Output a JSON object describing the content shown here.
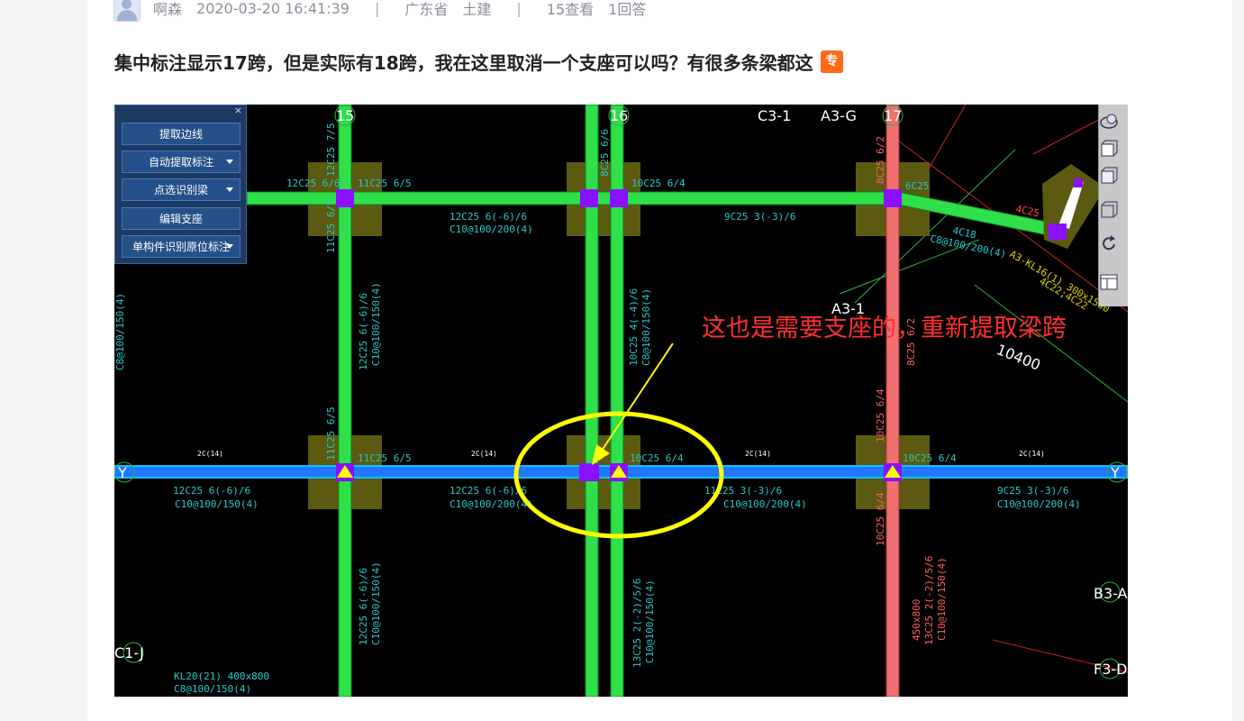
{
  "meta": {
    "author": "啊森",
    "datetime": "2020-03-20 16:41:39",
    "region": "广东省",
    "category": "土建",
    "views": "15查看",
    "answers": "1回答"
  },
  "question": {
    "title": "集中标注显示17跨，但是实际有18跨，我在这里取消一个支座可以吗？有很多条梁都这",
    "badge": "专"
  },
  "toolbar": {
    "close": "×",
    "buttons": [
      "提取边线",
      "自动提取标注",
      "点选识别梁",
      "编辑支座",
      "单构件识别原位标注"
    ]
  },
  "cad": {
    "axis_labels": [
      "15",
      "16",
      "17",
      "C3-1",
      "A3-G",
      "A3-1",
      "C1-J",
      "B3-A",
      "F3-D"
    ],
    "y_label": "Y",
    "dimension": "10400",
    "annotation": "这也是需要支座的，重新提取梁跨",
    "beam_text": {
      "t1": "12C25 6/6",
      "t2": "11C25 6/5",
      "t3": "10C25 6/4",
      "t4": "6C25",
      "t5": "12C25 6(-6)/6",
      "t6": "C10@100/200(4)",
      "t7": "9C25 3(-3)/6",
      "t8": "4C18",
      "t9": "C8@100/200(4)",
      "t10": "4C25",
      "t11": "A3-KL16(1) 300x1500",
      "t12": "4C22;4C22",
      "t13": "8C25 6/2",
      "t14": "12C25 7/5",
      "t15": "11C25 6/5",
      "t16": "C10@100/150(4)",
      "t17": "12C25 6(-6)/6",
      "t18": "10C25 4(-4)/6",
      "t19": "C8@100/150(4)",
      "t20": "8C25 6/6",
      "t21": "C8@100/150(4)",
      "t22": "2C(14)",
      "t23": "12C25 6(-6)/6",
      "t24": "C10@100/150(4)",
      "t25": "12C25 6(-6)/6",
      "t26": "C10@100/200(4)",
      "t27": "11C25 3(-3)/6",
      "t28": "C10@100/200(4)",
      "t29": "9C25 3(-3)/6",
      "t30": "C10@100/200(4)",
      "t31": "10C25 6/4",
      "t32": "12C25 6(-6)/6",
      "t33": "C10@100/150(4)",
      "t34": "13C25 2(-2)/5/6",
      "t35": "C10@100/150(4)",
      "t36": "450x800",
      "t37": "13C25 2(-2)/5/6",
      "t38": "C10@100/150(4)",
      "t39": "KL20(21) 400x800",
      "t40": "C8@100/150(4)",
      "t41": "11C25 6/5"
    }
  },
  "colors": {
    "green": "#2fe04a",
    "blue": "#2277ff",
    "pink": "#f07070",
    "pad": "#5c5a10",
    "purple": "#8a10ff",
    "yellow": "#ffff00",
    "cyan": "#27c9c9",
    "orange_badge": "#ff6a1a"
  }
}
